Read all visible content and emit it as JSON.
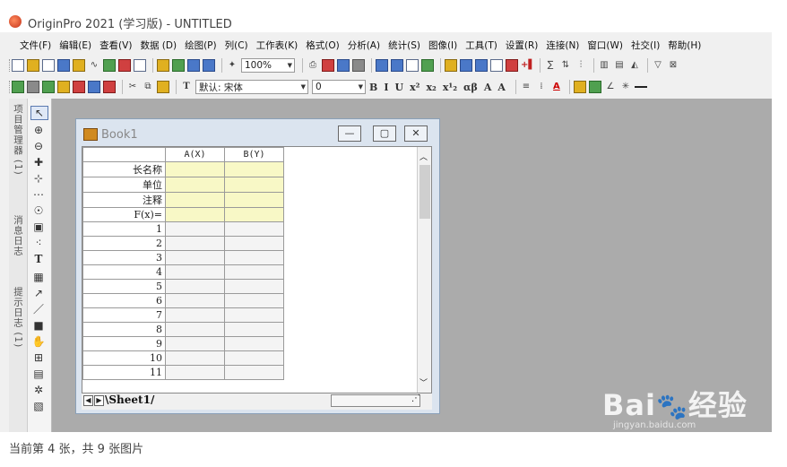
{
  "window": {
    "title": "OriginPro 2021 (学习版) - UNTITLED"
  },
  "menubar": [
    "文件(F)",
    "编辑(E)",
    "查看(V)",
    "数据 (D)",
    "绘图(P)",
    "列(C)",
    "工作表(K)",
    "格式(O)",
    "分析(A)",
    "统计(S)",
    "图像(I)",
    "工具(T)",
    "设置(R)",
    "连接(N)",
    "窗口(W)",
    "社交(I)",
    "帮助(H)"
  ],
  "toolbar": {
    "zoom": "100%",
    "font": "默认: 宋体",
    "font_size": "0",
    "symbols": [
      "B",
      "I",
      "U",
      "x²",
      "x₂",
      "x¹₂",
      "αβ",
      "A",
      "A"
    ]
  },
  "panels": {
    "project_manager": "项目管理器 (1)",
    "messages": "消息日志",
    "hints": "提示日志 (1)"
  },
  "book": {
    "title": "Book1",
    "columns": [
      "A(X)",
      "B(Y)"
    ],
    "meta_rows": [
      "长名称",
      "单位",
      "注释",
      "F(x)="
    ],
    "data_rows": [
      "1",
      "2",
      "3",
      "4",
      "5",
      "6",
      "7",
      "8",
      "9",
      "10",
      "11"
    ],
    "sheet": "Sheet1"
  },
  "watermark": {
    "brand": "Bai",
    "suffix": "经验",
    "site": "jingyan.baidu.com"
  },
  "caption": "当前第 4 张，共 9 张图片"
}
